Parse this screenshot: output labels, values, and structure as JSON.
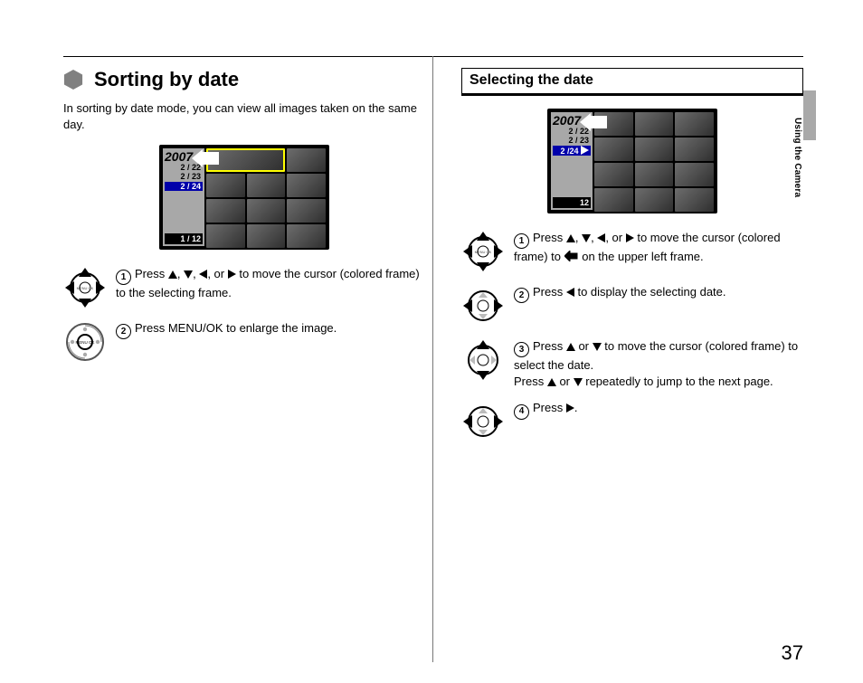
{
  "page_number": "37",
  "side_label": "Using the Camera",
  "left": {
    "title": "Sorting by date",
    "intro": "In sorting by date mode, you can view all images taken on the same day.",
    "screen": {
      "year": "2007",
      "d1": "2 / 22",
      "d2": "2 / 23",
      "d3": "2 / 24",
      "count": "1 / 12"
    },
    "s1_a": "Press ",
    "s1_b": " to move the cursor (colored frame) to the selecting frame.",
    "s2": "Press MENU/OK to enlarge the image.",
    "sep_comma": ", ",
    "sep_or": ", or "
  },
  "right": {
    "title": "Selecting the date",
    "screen": {
      "year": "2007",
      "d1": "2 / 22",
      "d2": "2 / 23",
      "d3": "2 /24",
      "count": "12"
    },
    "s1_a": "Press ",
    "s1_b": " to move the cursor (colored frame) to ",
    "s1_c": " on the upper left frame.",
    "s2_a": "Press ",
    "s2_b": " to display the selecting date.",
    "s3a_a": "Press ",
    "s3a_b": " to move the cursor (colored frame) to select the date.",
    "s3b_a": "Press ",
    "s3b_b": " repeatedly to jump to the next page.",
    "s4_a": "Press ",
    "s4_b": ".",
    "sep_comma": ", ",
    "sep_or": ", or ",
    "sep_or2": " or "
  }
}
